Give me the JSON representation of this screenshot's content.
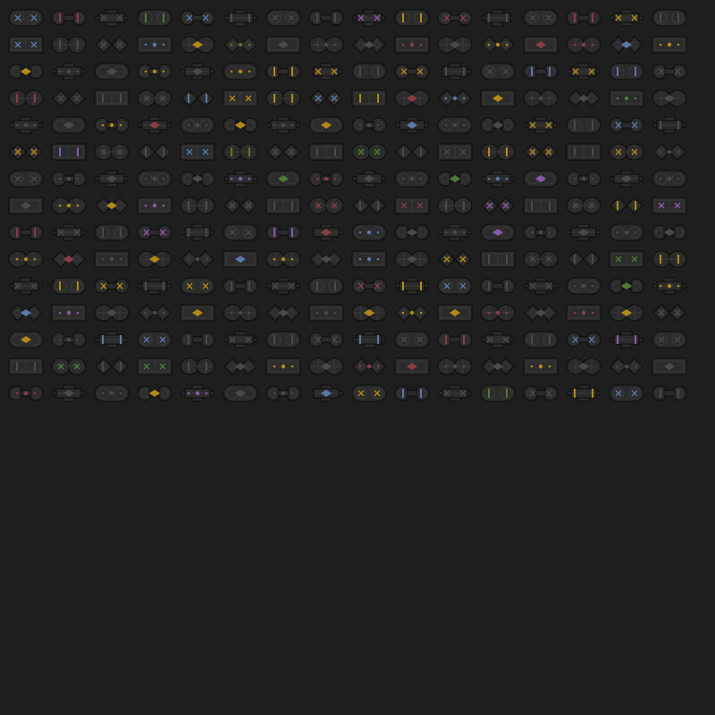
{
  "sheet": {
    "background": "#1e1e1e",
    "columns": 16,
    "rows": 15,
    "tile_count": 240,
    "body_color": "#2b2b2b",
    "outline_color": "#0c0c0c",
    "detail_color": "#3a3a3a",
    "accent_palette": {
      "blue": "#5c78a8",
      "red": "#8a3c44",
      "yellow": "#b08a18",
      "green": "#4e7a36",
      "purple": "#8a5aa8",
      "orange": "#a87a18",
      "grey": "#4a4a4a"
    },
    "shape_kinds": [
      "capsule",
      "rect",
      "dumbbell",
      "twin-disc",
      "cross",
      "diamond-pair"
    ],
    "accent_sequence": [
      "blue",
      "red",
      "grey",
      "green",
      "blue",
      "grey",
      "grey",
      "grey",
      "purple",
      "yellow",
      "red",
      "grey",
      "grey",
      "red",
      "yellow",
      "grey",
      "blue",
      "grey",
      "grey",
      "blue",
      "yellow",
      "green",
      "grey",
      "grey",
      "grey",
      "red",
      "grey",
      "yellow",
      "red",
      "red",
      "blue",
      "yellow",
      "yellow",
      "grey",
      "grey",
      "yellow",
      "grey",
      "yellow",
      "yellow",
      "yellow",
      "grey",
      "yellow",
      "grey",
      "grey",
      "blue",
      "yellow",
      "blue",
      "grey",
      "red",
      "grey",
      "grey",
      "grey",
      "blue",
      "yellow",
      "yellow",
      "blue",
      "yellow",
      "red",
      "blue",
      "yellow",
      "grey",
      "grey",
      "green",
      "grey",
      "grey",
      "grey",
      "yellow",
      "red",
      "grey",
      "yellow",
      "grey",
      "yellow",
      "grey",
      "blue",
      "grey",
      "grey",
      "yellow",
      "grey",
      "blue",
      "grey",
      "yellow",
      "purple",
      "grey",
      "grey",
      "blue",
      "green",
      "grey",
      "grey",
      "green",
      "grey",
      "grey",
      "yellow",
      "yellow",
      "grey",
      "yellow",
      "grey",
      "grey",
      "grey",
      "grey",
      "grey",
      "grey",
      "purple",
      "green",
      "red",
      "grey",
      "grey",
      "green",
      "blue",
      "purple",
      "grey",
      "grey",
      "grey",
      "grey",
      "yellow",
      "yellow",
      "purple",
      "grey",
      "grey",
      "grey",
      "red",
      "grey",
      "red",
      "grey",
      "purple",
      "grey",
      "grey",
      "yellow",
      "purple",
      "red",
      "grey",
      "grey",
      "purple",
      "grey",
      "grey",
      "purple",
      "red",
      "blue",
      "grey",
      "grey",
      "purple",
      "grey",
      "grey",
      "grey",
      "grey",
      "yellow",
      "red",
      "grey",
      "yellow",
      "grey",
      "blue",
      "yellow",
      "grey",
      "blue",
      "grey",
      "yellow",
      "grey",
      "grey",
      "grey",
      "green",
      "yellow",
      "grey",
      "yellow",
      "yellow",
      "grey",
      "yellow",
      "grey",
      "grey",
      "grey",
      "red",
      "yellow",
      "blue",
      "grey",
      "grey",
      "grey",
      "green",
      "yellow",
      "blue",
      "purple",
      "grey",
      "grey",
      "yellow",
      "grey",
      "grey",
      "grey",
      "yellow",
      "yellow",
      "yellow",
      "red",
      "grey",
      "red",
      "yellow",
      "grey",
      "yellow",
      "grey",
      "blue",
      "blue",
      "grey",
      "grey",
      "grey",
      "grey",
      "blue",
      "grey",
      "red",
      "grey",
      "grey",
      "blue",
      "purple",
      "grey",
      "grey",
      "green",
      "grey",
      "green",
      "grey",
      "grey",
      "yellow",
      "grey",
      "red",
      "red",
      "grey",
      "grey",
      "yellow",
      "grey",
      "grey",
      "grey",
      "red",
      "grey",
      "grey",
      "yellow",
      "purple",
      "grey",
      "grey",
      "blue",
      "yellow",
      "blue",
      "grey",
      "green",
      "grey",
      "yellow",
      "blue",
      "grey"
    ]
  }
}
